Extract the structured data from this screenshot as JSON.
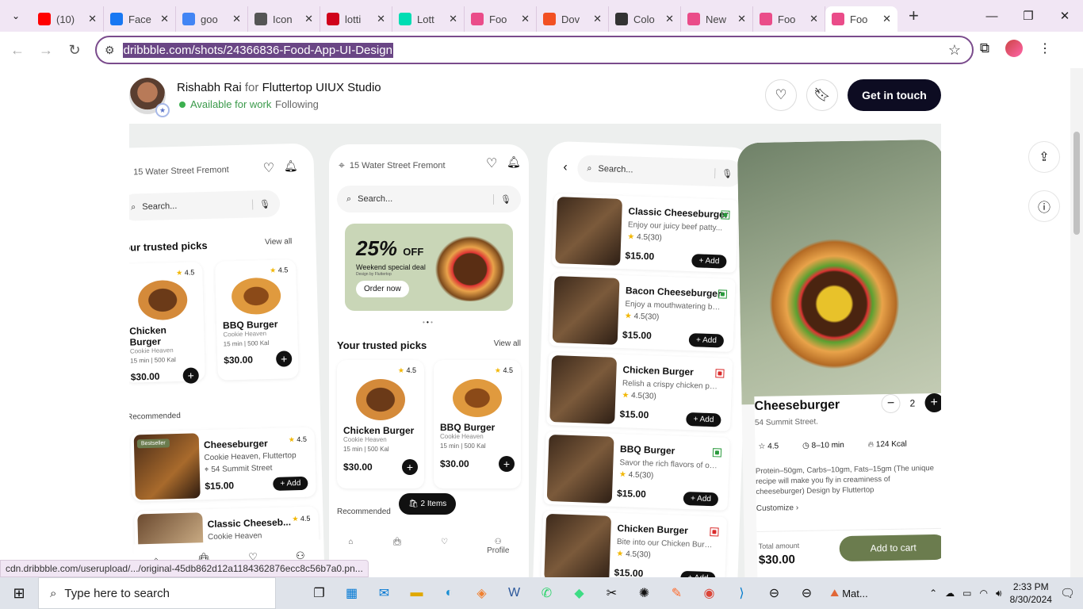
{
  "browser": {
    "tabs": [
      {
        "title": "(10)",
        "icon": "youtube-icon",
        "color": "#ff0000"
      },
      {
        "title": "Face",
        "icon": "facebook-icon",
        "color": "#1877f2"
      },
      {
        "title": "goo",
        "icon": "google-icon",
        "color": "#4285f4"
      },
      {
        "title": "Icon",
        "icon": "iconscout-icon",
        "color": "#555555"
      },
      {
        "title": "lotti",
        "icon": "lottie-icon",
        "color": "#d0021b"
      },
      {
        "title": "Lott",
        "icon": "lottiefiles-icon",
        "color": "#00ddb3"
      },
      {
        "title": "Foo",
        "icon": "dribbble-icon",
        "color": "#ea4c89"
      },
      {
        "title": "Dov",
        "icon": "microsoft-icon",
        "color": "#f25022"
      },
      {
        "title": "Colo",
        "icon": "cup-icon",
        "color": "#333333"
      },
      {
        "title": "New",
        "icon": "dribbble-icon",
        "color": "#ea4c89"
      },
      {
        "title": "Foo",
        "icon": "dribbble-icon",
        "color": "#ea4c89"
      },
      {
        "title": "Foo",
        "icon": "dribbble-icon",
        "color": "#ea4c89",
        "active": true
      }
    ],
    "url": "dribbble.com/shots/24366836-Food-App-UI-Design",
    "status_url": "cdn.dribbble.com/userupload/.../original-45db862d12a1184362876ecc8c56b7a0.pn..."
  },
  "header": {
    "author": "Rishabh Rai",
    "for": "for",
    "studio": "Fluttertop UIUX Studio",
    "availability": "Available for work",
    "following": "Following",
    "get_in_touch": "Get in touch"
  },
  "phone1": {
    "location": "15 Water Street Fremont",
    "search_placeholder": "Search...",
    "trusted_title": "Your trusted picks",
    "view_all": "View all",
    "cards": [
      {
        "name": "Chicken Burger",
        "brand": "Cookie Heaven",
        "meta": "15 min | 500 Kal",
        "price": "$30.00",
        "rating": "4.5"
      },
      {
        "name": "BBQ Burger",
        "brand": "Cookie Heaven",
        "meta": "15 min | 500 Kal",
        "price": "$30.00",
        "rating": "4.5"
      }
    ],
    "recommended_title": "Recommended",
    "rec_items": [
      {
        "badge": "Bestseller",
        "name": "Cheeseburger",
        "brand": "Cookie Heaven, Fluttertop",
        "address": "54 Summit Street",
        "price": "$15.00",
        "rating": "4.5",
        "add": "Add"
      },
      {
        "name": "Classic Cheeseb...",
        "brand": "Cookie Heaven",
        "rating": "4.5"
      }
    ]
  },
  "phone2": {
    "location": "15 Water Street Fremont",
    "search_placeholder": "Search...",
    "promo_percent": "25%",
    "promo_off": "OFF",
    "promo_sub": "Weekend special deal",
    "promo_small": "Design by Fluttertop",
    "order_now": "Order now",
    "trusted_title": "Your trusted picks",
    "view_all": "View all",
    "cards": [
      {
        "name": "Chicken Burger",
        "brand": "Cookie Heaven",
        "meta": "15 min | 500 Kal",
        "price": "$30.00",
        "rating": "4.5"
      },
      {
        "name": "BBQ Burger",
        "brand": "Cookie Heaven",
        "meta": "15 min | 500 Kal",
        "price": "$30.00",
        "rating": "4.5"
      }
    ],
    "recommended_title": "Recommended",
    "cart_pill": "2 Items",
    "nav": [
      "Home",
      "My Order",
      "Saved",
      "Profile"
    ]
  },
  "phone3": {
    "search_placeholder": "Search...",
    "items": [
      {
        "name": "Classic Cheeseburger",
        "desc": "Enjoy our juicy beef patty...",
        "rating": "4.5(30)",
        "price": "$15.00",
        "add": "Add",
        "veg": true
      },
      {
        "name": "Bacon Cheeseburger",
        "desc": "Enjoy a mouthwatering bac...",
        "rating": "4.5(30)",
        "price": "$15.00",
        "add": "Add",
        "veg": true
      },
      {
        "name": "Chicken Burger",
        "desc": "Relish a crispy chicken patty...",
        "rating": "4.5(30)",
        "price": "$15.00",
        "add": "Add",
        "veg": false
      },
      {
        "name": "BBQ Burger",
        "desc": "Savor the rich flavors of our...",
        "rating": "4.5(30)",
        "price": "$15.00",
        "add": "Add",
        "veg": true
      },
      {
        "name": "Chicken Burger",
        "desc": "Bite into our Chicken Burger...",
        "rating": "4.5(30)",
        "price": "$15.00",
        "add": "Add",
        "veg": false
      }
    ]
  },
  "phone4": {
    "title": "Cheeseburger",
    "address": "54 Summit Street.",
    "qty": "2",
    "rating": "4.5",
    "time": "8–10 min",
    "kcal": "124 Kcal",
    "desc": "Protein–50gm, Carbs–10gm, Fats–15gm (The unique recipe will make you fly in creaminess of cheeseburger) Design by Fluttertop",
    "customize": "Customize",
    "total_label": "Total amount",
    "total": "$30.00",
    "add_to_cart": "Add to cart"
  },
  "taskbar": {
    "search_placeholder": "Type here to search",
    "matlab": "Mat...",
    "time": "2:33 PM",
    "date": "8/30/2024"
  },
  "colors": {
    "accent": "#6a4685",
    "dark": "#0d0c22",
    "green": "#6b7c4e"
  }
}
